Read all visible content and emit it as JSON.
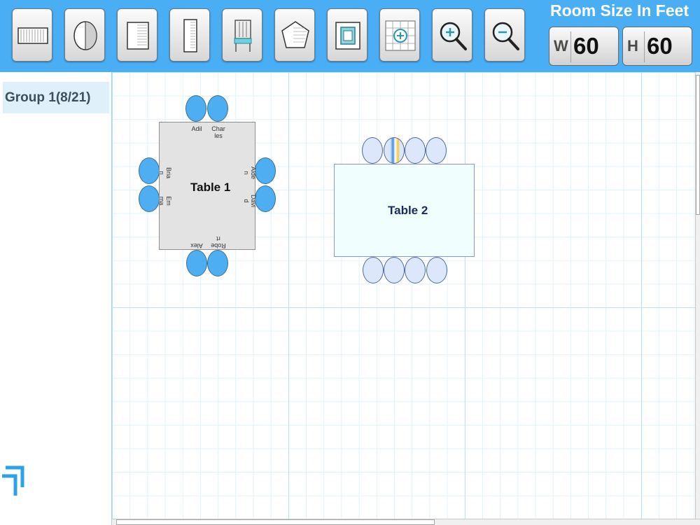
{
  "toolbar": {
    "tools": [
      {
        "name": "rectangle-table-tool"
      },
      {
        "name": "round-table-tool"
      },
      {
        "name": "square-table-tool"
      },
      {
        "name": "long-table-tool"
      },
      {
        "name": "chair-tool"
      },
      {
        "name": "custom-shape-tool"
      },
      {
        "name": "fit-to-screen-tool"
      },
      {
        "name": "add-grid-tool"
      },
      {
        "name": "zoom-in-tool"
      },
      {
        "name": "zoom-out-tool"
      }
    ],
    "room_size_title": "Room Size In Feet",
    "width_letter": "W",
    "width_value": "60",
    "height_letter": "H",
    "height_value": "60"
  },
  "sidebar": {
    "group_label": "Group 1(8/21)"
  },
  "tables": [
    {
      "label": "Table 1",
      "guests_top": [
        "Adil",
        "Char\nles"
      ],
      "guests_left": [
        "Bria\nn",
        "Em\nma"
      ],
      "guests_right": [
        "Alde\nn",
        "Davi\nd"
      ],
      "guests_bottom": [
        "Alex",
        "Robe\nrt"
      ]
    },
    {
      "label": "Table 2"
    }
  ],
  "colors": {
    "toolbar_bg": "#4aaef5",
    "seat_filled": "#4eaef2",
    "seat_empty": "#dce7fb"
  }
}
